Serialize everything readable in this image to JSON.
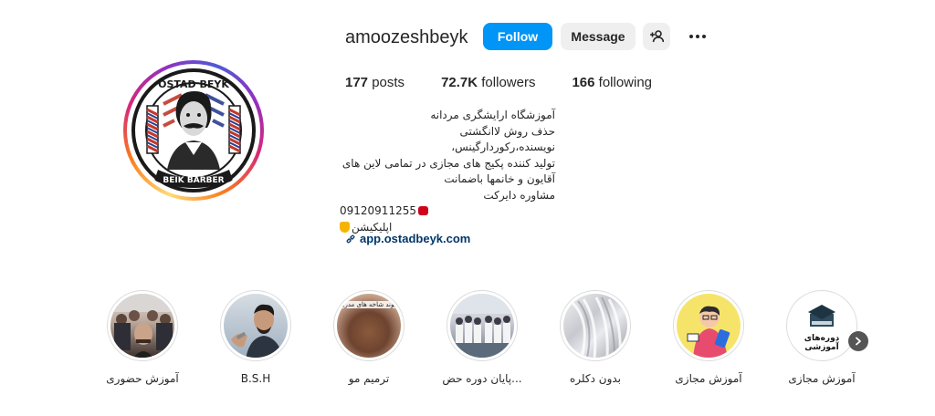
{
  "profile": {
    "username": "amoozeshbeyk",
    "follow_label": "Follow",
    "message_label": "Message",
    "avatar_text_top": "OSTAD BEYK",
    "avatar_text_bottom": "BEIK BARBER"
  },
  "stats": {
    "posts_count": "177",
    "posts_label": "posts",
    "followers_count": "72.7K",
    "followers_label": "followers",
    "following_count": "166",
    "following_label": "following"
  },
  "bio": {
    "name": "آموزشگاه ارایشگری مردانه",
    "lines": [
      "حذف روش لاانگشتی",
      "نویسنده،رکوردارگینس،",
      "تولید کننده پکیج های مجازی در تمامی لاین های",
      "آقایون و خانمها باضمانت",
      "مشاوره دایرکت",
      "09120911255",
      "اپلیکیشن"
    ],
    "link": "app.ostadbeyk.com"
  },
  "highlights": [
    {
      "label": "آموزش حضوری",
      "icon": "photo-group"
    },
    {
      "label": "B.S.H",
      "icon": "photo-man"
    },
    {
      "label": "ترمیم مو",
      "icon": "photo-hair",
      "overlay": "پیوند شاخه های مدرن"
    },
    {
      "label": "پایان دوره حض...",
      "icon": "photo-graduation"
    },
    {
      "label": "بدون دکلره",
      "icon": "photo-blonde"
    },
    {
      "label": "آموزش مجازی",
      "icon": "photo-cartoon"
    },
    {
      "label": "آموزش مجازی",
      "icon": "graduation-cap",
      "overlay": "دوره‌های آموزشی"
    }
  ],
  "colors": {
    "follow": "#0095f6",
    "link": "#00376b",
    "secondary_button": "#efefef"
  }
}
